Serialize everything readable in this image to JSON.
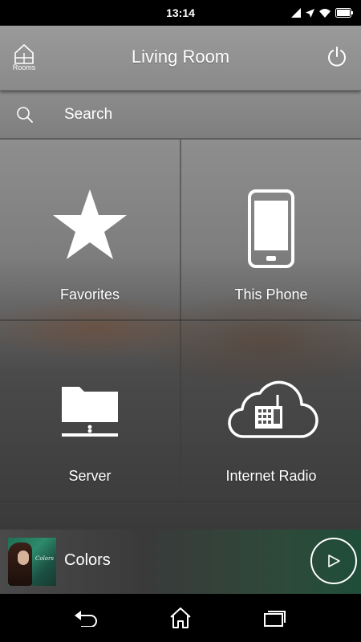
{
  "status_bar": {
    "time": "13:14"
  },
  "header": {
    "title": "Living Room",
    "rooms_label": "Rooms"
  },
  "search": {
    "placeholder": "Search"
  },
  "tiles": [
    {
      "label": "Favorites",
      "icon": "star-icon"
    },
    {
      "label": "This Phone",
      "icon": "phone-icon"
    },
    {
      "label": "Server",
      "icon": "folder-server-icon"
    },
    {
      "label": "Internet Radio",
      "icon": "cloud-radio-icon"
    }
  ],
  "now_playing": {
    "track": "Colors",
    "album_art_text": "Colors"
  },
  "colors": {
    "header": "#8f8f8f",
    "status_bar": "#000000",
    "nav_bar": "#000000",
    "now_playing_accent": "#1f4d3a"
  }
}
